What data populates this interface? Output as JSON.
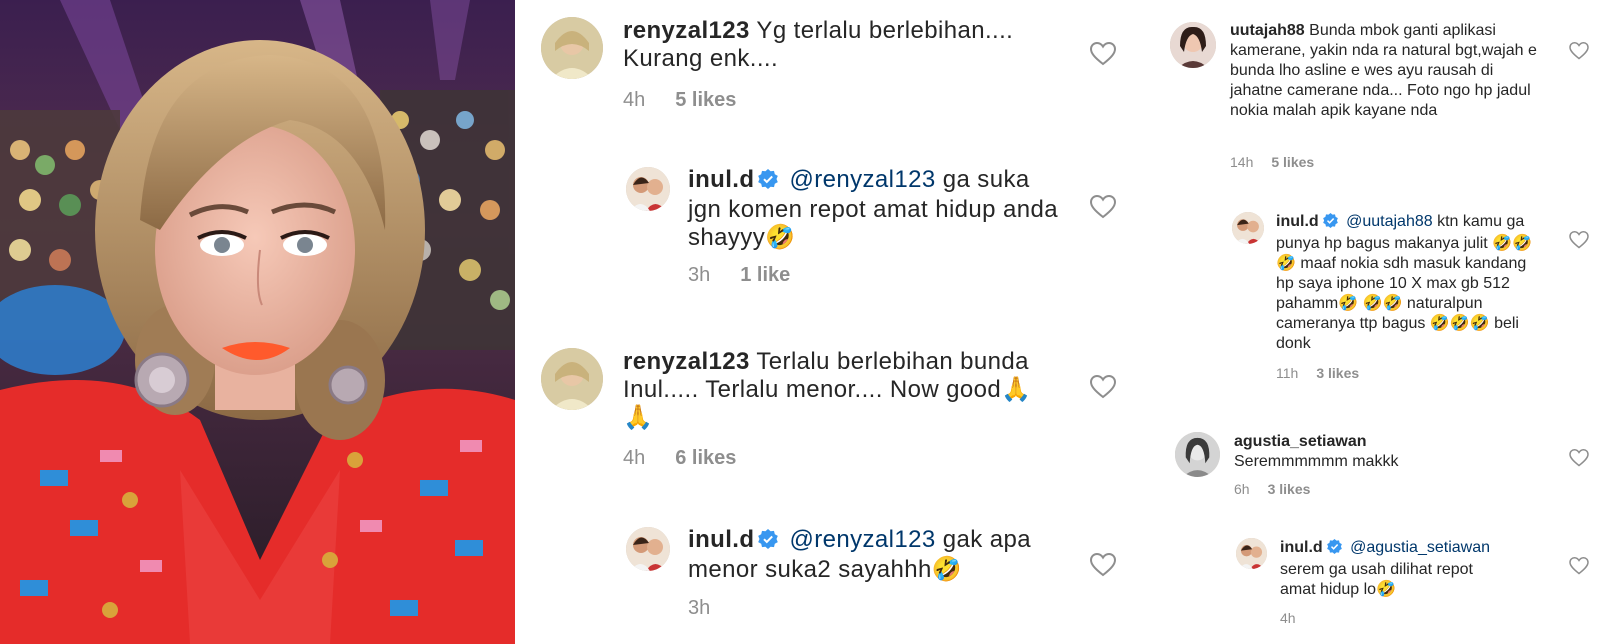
{
  "comments_a": [
    {
      "username": "renyzal123",
      "verified": false,
      "mention": "",
      "text": "Yg terlalu berlebihan.... Kurang enk....",
      "time": "4h",
      "likes": "5 likes"
    },
    {
      "username": "inul.d",
      "verified": true,
      "mention": "@renyzal123",
      "text": "ga suka jgn komen repot amat hidup anda shayyy🤣",
      "time": "3h",
      "likes": "1 like"
    },
    {
      "username": "renyzal123",
      "verified": false,
      "mention": "",
      "text": "Terlalu berlebihan bunda Inul..... Terlalu menor.... Now good🙏 🙏",
      "time": "4h",
      "likes": "6 likes"
    },
    {
      "username": "inul.d",
      "verified": true,
      "mention": "@renyzal123",
      "text": "gak apa menor suka2 sayahhh🤣",
      "time": "3h",
      "likes": ""
    }
  ],
  "comments_b": [
    {
      "username": "uutajah88",
      "verified": false,
      "mention": "",
      "text": "Bunda mbok ganti aplikasi kamerane, yakin nda ra natural bgt,wajah e bunda lho asline e wes ayu rausah di jahatne camerane nda... Foto ngo hp jadul nokia malah apik kayane nda",
      "time": "14h",
      "likes": "5 likes"
    },
    {
      "username": "inul.d",
      "verified": true,
      "mention": "@uutajah88",
      "text": "ktn kamu ga punya hp bagus makanya julit 🤣🤣🤣 maaf nokia sdh masuk kandang hp saya iphone 10 X max gb 512 pahamm🤣 🤣🤣 naturalpun cameranya ttp bagus 🤣🤣🤣 beli donk",
      "time": "11h",
      "likes": "3 likes"
    },
    {
      "username": "agustia_setiawan",
      "verified": false,
      "mention": "",
      "text": "Seremmmmmm makkk",
      "time": "6h",
      "likes": "3 likes"
    },
    {
      "username": "inul.d",
      "verified": true,
      "mention": "@agustia_setiawan",
      "text": "serem ga usah dilihat repot amat hidup lo🤣",
      "time": "4h",
      "likes": ""
    }
  ],
  "icons": {
    "like": "heart-outline-icon",
    "verified": "verified-badge-icon"
  },
  "colors": {
    "text": "#262626",
    "meta": "#8e8e8e",
    "mention": "#00376b",
    "verified": "#3897f0"
  }
}
